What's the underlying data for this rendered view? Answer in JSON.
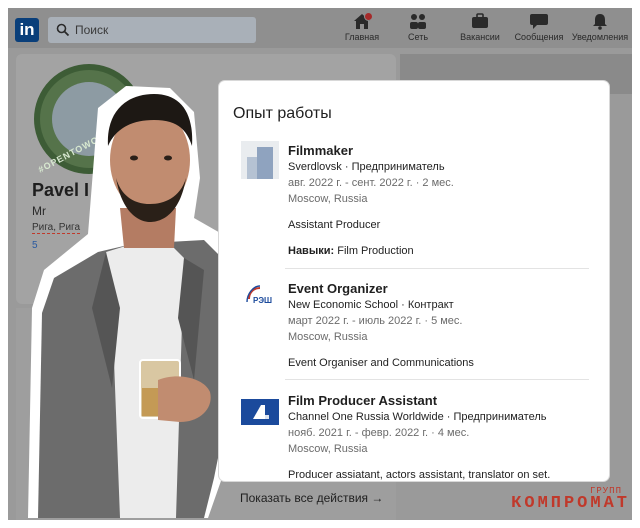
{
  "nav": {
    "logo": "in",
    "search_placeholder": "Поиск",
    "items": [
      {
        "label": "Главная",
        "icon": "home-icon"
      },
      {
        "label": "Сеть",
        "icon": "network-icon"
      },
      {
        "label": "Вакансии",
        "icon": "briefcase-icon"
      },
      {
        "label": "Сообщения",
        "icon": "messages-icon"
      },
      {
        "label": "Уведомления",
        "icon": "bell-icon"
      }
    ]
  },
  "profile": {
    "name": "Pavel I",
    "headline": "Mr",
    "location": "Рига, Рига",
    "connections": "5",
    "badge": "#OPENTOWORK"
  },
  "experience": {
    "title": "Опыт работы",
    "jobs": [
      {
        "title": "Filmmaker",
        "company": "Sverdlovsk · Предприниматель",
        "dates": "авг. 2022 г. - сент. 2022 г. · 2 мес.",
        "location": "Moscow, Russia",
        "description": "Assistant Producer",
        "skills_label": "Навыки:",
        "skills": "Film Production",
        "logo": "placeholder-logo-icon"
      },
      {
        "title": "Event Organizer",
        "company": "New Economic School · Контракт",
        "dates": "март 2022 г. - июль 2022 г. · 5 мес.",
        "location": "Moscow, Russia",
        "description": "Event Organiser and Communications",
        "logo_text": "РЭШ",
        "logo": "nes-logo-icon"
      },
      {
        "title": "Film Producer Assistant",
        "company": "Channel One Russia Worldwide · Предприниматель",
        "dates": "нояб. 2021 г. - февр. 2022 г. · 4 мес.",
        "location": "Moscow, Russia",
        "description": "Producer assiatant, actors assistant, translator on set.",
        "logo": "channel-one-logo-icon"
      }
    ],
    "show_all": "Показать все действия →"
  },
  "watermark": {
    "small": "ГРУПП",
    "big": "КОМПРОМАТ"
  },
  "colors": {
    "linkedin_blue": "#0a3f7a",
    "channel_one_blue": "#1b4a9c",
    "watermark_red": "#c0392b"
  }
}
